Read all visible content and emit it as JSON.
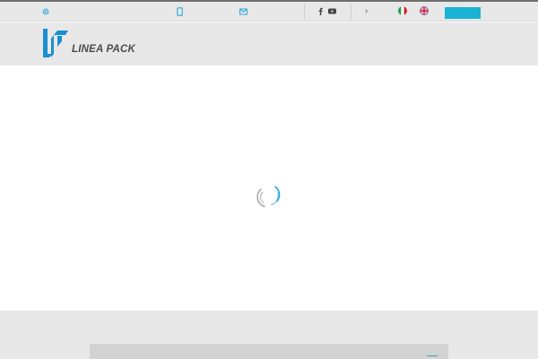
{
  "topbar": {
    "email_icon": "at-sign-icon",
    "phone_icon": "phone-icon",
    "contact_icon": "mail-icon",
    "social": [
      "facebook-icon",
      "youtube-icon"
    ],
    "menu_icon": "caret-icon",
    "languages": [
      {
        "code": "it",
        "icon": "italy-flag-icon"
      },
      {
        "code": "en",
        "icon": "uk-flag-icon"
      }
    ],
    "cta_label": ""
  },
  "brand": {
    "name": "LINEA PACK",
    "accent": "#1a8fd0",
    "button_color": "#19b3d6"
  },
  "loader": {
    "icon": "loading-spinner-icon"
  }
}
